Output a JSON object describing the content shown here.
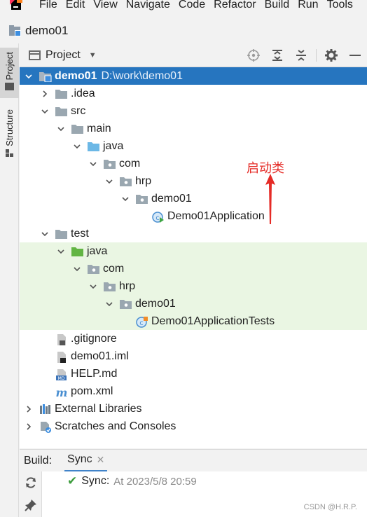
{
  "menubar": {
    "items": [
      "File",
      "Edit",
      "View",
      "Navigate",
      "Code",
      "Refactor",
      "Build",
      "Run",
      "Tools"
    ]
  },
  "navbar": {
    "title": "demo01"
  },
  "left_strip": {
    "project": "Project",
    "structure": "Structure"
  },
  "panel": {
    "title": "Project",
    "tree": [
      {
        "label": "demo01",
        "path": "D:\\work\\demo01",
        "depth": 0,
        "arrow": "down",
        "icon": "module-folder-icon",
        "selected": true
      },
      {
        "label": ".idea",
        "depth": 1,
        "arrow": "right",
        "icon": "folder-icon"
      },
      {
        "label": "src",
        "depth": 1,
        "arrow": "down",
        "icon": "folder-icon"
      },
      {
        "label": "main",
        "depth": 2,
        "arrow": "down",
        "icon": "folder-icon"
      },
      {
        "label": "java",
        "depth": 3,
        "arrow": "down",
        "icon": "source-folder-icon"
      },
      {
        "label": "com",
        "depth": 4,
        "arrow": "down",
        "icon": "package-icon"
      },
      {
        "label": "hrp",
        "depth": 5,
        "arrow": "down",
        "icon": "package-icon"
      },
      {
        "label": "demo01",
        "depth": 6,
        "arrow": "down",
        "icon": "package-icon"
      },
      {
        "label": "Demo01Application",
        "depth": 7,
        "arrow": "none",
        "icon": "spring-app-class-icon"
      },
      {
        "label": "test",
        "depth": 1,
        "arrow": "down",
        "icon": "folder-icon"
      },
      {
        "label": "java",
        "depth": 2,
        "arrow": "down",
        "icon": "test-folder-icon",
        "test": true
      },
      {
        "label": "com",
        "depth": 3,
        "arrow": "down",
        "icon": "package-icon",
        "test": true
      },
      {
        "label": "hrp",
        "depth": 4,
        "arrow": "down",
        "icon": "package-icon",
        "test": true
      },
      {
        "label": "demo01",
        "depth": 5,
        "arrow": "down",
        "icon": "package-icon",
        "test": true
      },
      {
        "label": "Demo01ApplicationTests",
        "depth": 6,
        "arrow": "none",
        "icon": "test-class-icon",
        "test": true
      },
      {
        "label": ".gitignore",
        "depth": 1,
        "arrow": "none",
        "icon": "gitignore-file-icon"
      },
      {
        "label": "demo01.iml",
        "depth": 1,
        "arrow": "none",
        "icon": "iml-file-icon"
      },
      {
        "label": "HELP.md",
        "depth": 1,
        "arrow": "none",
        "icon": "markdown-file-icon"
      },
      {
        "label": "pom.xml",
        "depth": 1,
        "arrow": "none",
        "icon": "maven-file-icon"
      },
      {
        "label": "External Libraries",
        "depth": 0,
        "arrow": "right",
        "icon": "libraries-icon"
      },
      {
        "label": "Scratches and Consoles",
        "depth": 0,
        "arrow": "right",
        "icon": "scratches-icon"
      }
    ]
  },
  "annotation": {
    "text": "启动类",
    "color": "#e52b26"
  },
  "bottom": {
    "label": "Build:",
    "tab": "Sync",
    "sync_status": "Sync:",
    "sync_time": "At 2023/5/8 20:59"
  },
  "watermark": "CSDN @H.R.P.",
  "colors": {
    "selection": "#2675bf",
    "test_background": "#eaf6e3",
    "folder": "#8c9aa8",
    "source_folder": "#6cb8e6",
    "test_folder": "#62b543"
  }
}
